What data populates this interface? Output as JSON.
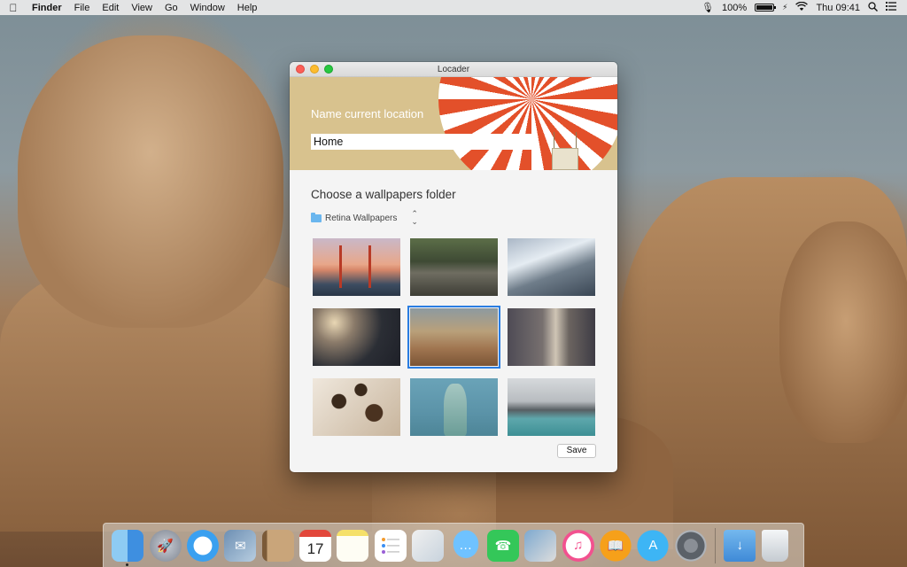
{
  "menubar": {
    "apple": "",
    "app_name": "Finder",
    "menus": [
      "File",
      "Edit",
      "View",
      "Go",
      "Window",
      "Help"
    ],
    "battery_percent": "100%",
    "clock": "Thu 09:41"
  },
  "window": {
    "title": "Locader",
    "name_label": "Name current location",
    "name_value": "Home",
    "section_title": "Choose a wallpapers folder",
    "folder_name": "Retina Wallpapers",
    "thumbnails": [
      {
        "name": "golden-gate"
      },
      {
        "name": "river-rocks"
      },
      {
        "name": "snowy-mountains"
      },
      {
        "name": "blossoms"
      },
      {
        "name": "mount-rushmore",
        "selected": true
      },
      {
        "name": "city-buildings"
      },
      {
        "name": "giraffe"
      },
      {
        "name": "statue-of-liberty"
      },
      {
        "name": "lake-mountains"
      }
    ],
    "save_label": "Save"
  },
  "dock": {
    "apps": [
      "Finder",
      "Launchpad",
      "Safari",
      "Mail",
      "Contacts",
      "Calendar",
      "Notes",
      "Reminders",
      "Photo Booth",
      "Messages",
      "FaceTime",
      "Preview",
      "iTunes",
      "iBooks",
      "App Store",
      "System Preferences",
      "Downloads",
      "Trash"
    ],
    "calendar_month": "JUL",
    "calendar_day": "17"
  },
  "colors": {
    "accent": "#2a7de1",
    "header_bg": "#d8c28e",
    "balloon_red": "#e3502a"
  }
}
